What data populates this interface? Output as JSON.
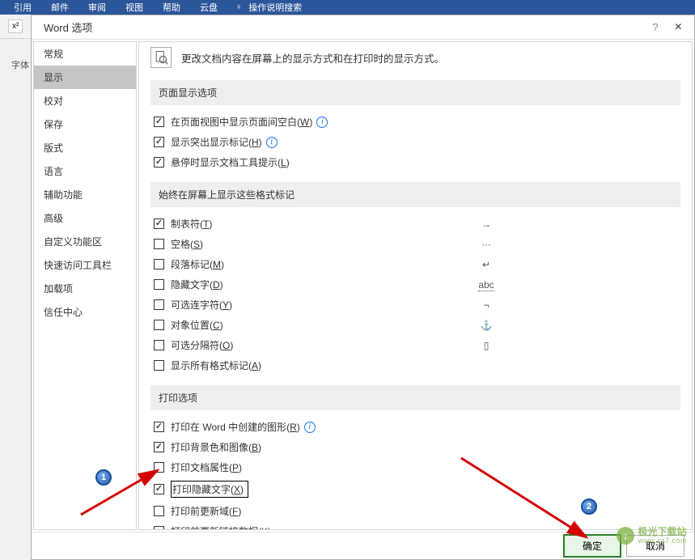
{
  "ribbon": {
    "items": [
      "引用",
      "邮件",
      "审阅",
      "视图",
      "帮助",
      "云盘"
    ],
    "search": "操作说明搜索"
  },
  "bg": {
    "fontLabel": "字体"
  },
  "dialog": {
    "title": "Word 选项",
    "help": "?",
    "close": "×"
  },
  "sidebar": {
    "items": [
      "常规",
      "显示",
      "校对",
      "保存",
      "版式",
      "语言",
      "辅助功能",
      "高级",
      "自定义功能区",
      "快速访问工具栏",
      "加载项",
      "信任中心"
    ]
  },
  "content": {
    "headerText": "更改文档内容在屏幕上的显示方式和在打印时的显示方式。",
    "section1": {
      "title": "页面显示选项",
      "opts": [
        {
          "checked": true,
          "label": "在页面视图中显示页面间空白(",
          "key": "W",
          "tail": ")",
          "info": true
        },
        {
          "checked": true,
          "label": "显示突出显示标记(",
          "key": "H",
          "tail": ")",
          "info": true
        },
        {
          "checked": true,
          "label": "悬停时显示文档工具提示(",
          "key": "L",
          "tail": ")"
        }
      ]
    },
    "section2": {
      "title": "始终在屏幕上显示这些格式标记",
      "opts": [
        {
          "checked": true,
          "label": "制表符(",
          "key": "T",
          "tail": ")",
          "symbol": "→"
        },
        {
          "checked": false,
          "label": "空格(",
          "key": "S",
          "tail": ")",
          "symbol": "···"
        },
        {
          "checked": false,
          "label": "段落标记(",
          "key": "M",
          "tail": ")",
          "symbol": "↵"
        },
        {
          "checked": false,
          "label": "隐藏文字(",
          "key": "D",
          "tail": ")",
          "symbol": "abc"
        },
        {
          "checked": false,
          "label": "可选连字符(",
          "key": "Y",
          "tail": ")",
          "symbol": "¬"
        },
        {
          "checked": false,
          "label": "对象位置(",
          "key": "C",
          "tail": ")",
          "symbol": "⚓"
        },
        {
          "checked": false,
          "label": "可选分隔符(",
          "key": "O",
          "tail": ")",
          "symbol": "▯"
        },
        {
          "checked": false,
          "label": "显示所有格式标记(",
          "key": "A",
          "tail": ")"
        }
      ]
    },
    "section3": {
      "title": "打印选项",
      "opts": [
        {
          "checked": true,
          "label": "打印在 Word 中创建的图形(",
          "key": "R",
          "tail": ")",
          "info": true
        },
        {
          "checked": true,
          "label": "打印背景色和图像(",
          "key": "B",
          "tail": ")"
        },
        {
          "checked": false,
          "label": "打印文档属性(",
          "key": "P",
          "tail": ")"
        },
        {
          "checked": true,
          "label": "打印隐藏文字(",
          "key": "X",
          "tail": ")",
          "highlight": true
        },
        {
          "checked": false,
          "label": "打印前更新域(",
          "key": "F",
          "tail": ")"
        },
        {
          "checked": false,
          "label": "打印前更新链接数据(",
          "key": "K",
          "tail": ")"
        }
      ]
    }
  },
  "footer": {
    "ok": "确定",
    "cancel": "取消"
  },
  "annotations": {
    "num1": "1",
    "num2": "2"
  },
  "watermark": {
    "name": "极光下载站",
    "url": "www.xz7.com"
  }
}
